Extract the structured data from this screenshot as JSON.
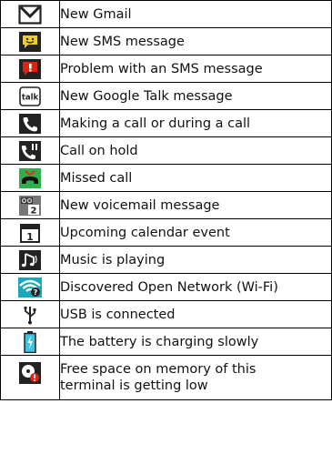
{
  "rows": [
    {
      "icon": "gmail-envelope-icon",
      "label": "New Gmail"
    },
    {
      "icon": "sms-message-icon",
      "label": "New SMS message"
    },
    {
      "icon": "sms-problem-icon",
      "label": "Problem with an SMS message"
    },
    {
      "icon": "google-talk-icon",
      "label": "New Google Talk message",
      "icon_text": "talk"
    },
    {
      "icon": "call-icon",
      "label": "Making a call or during a call"
    },
    {
      "icon": "call-on-hold-icon",
      "label": "Call on hold"
    },
    {
      "icon": "missed-call-icon",
      "label": "Missed call"
    },
    {
      "icon": "voicemail-icon",
      "label": "New voicemail message",
      "icon_text": "2"
    },
    {
      "icon": "calendar-event-icon",
      "label": "Upcoming calendar event",
      "icon_text": "1"
    },
    {
      "icon": "music-playing-icon",
      "label": "Music is playing"
    },
    {
      "icon": "open-wifi-icon",
      "label": "Discovered Open Network (Wi-Fi)"
    },
    {
      "icon": "usb-icon",
      "label": "USB is connected"
    },
    {
      "icon": "battery-charging-icon",
      "label": "The battery is charging slowly"
    },
    {
      "icon": "low-memory-icon",
      "label": "Free space on memory of this terminal is getting low"
    }
  ],
  "colors": {
    "icon_dark": "#222222",
    "sms_yellow": "#f0d020",
    "alert_red": "#e02010",
    "call_green": "#2fb04a",
    "missed_red": "#e03020",
    "wifi_teal": "#1aa7b8",
    "battery_cyan": "#3ec3e0"
  }
}
